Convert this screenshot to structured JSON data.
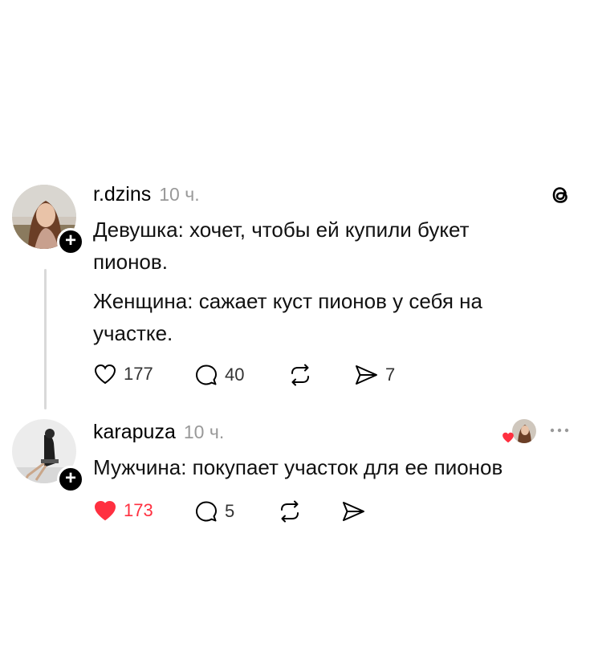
{
  "posts": [
    {
      "username": "r.dzins",
      "time": "10 ч.",
      "paragraphs": [
        "Девушка: хочет, чтобы ей купили букет",
        "пионов.",
        "Женщина: сажает куст пионов у себя на",
        "участке."
      ],
      "likes": "177",
      "replies": "40",
      "shares": "7",
      "liked": false
    },
    {
      "username": "karapuza",
      "time": "10 ч.",
      "paragraphs": [
        "Мужчина: покупает участок для ее пионов"
      ],
      "likes": "173",
      "replies": "5",
      "liked": true
    }
  ],
  "icons": {
    "app_logo": "threads-logo-icon",
    "like": "heart-icon",
    "reply": "comment-icon",
    "repost": "repost-icon",
    "share": "send-icon",
    "more": "more-dots-icon"
  },
  "colors": {
    "like_red": "#ff3040",
    "muted": "#999999"
  }
}
